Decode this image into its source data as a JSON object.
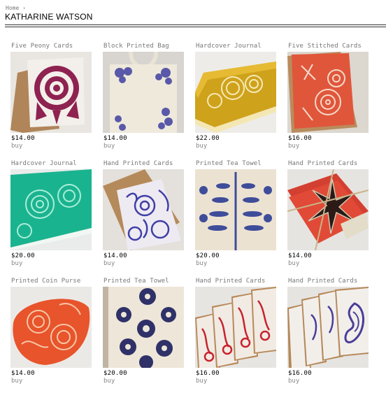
{
  "breadcrumb": {
    "home": "Home",
    "separator": "›"
  },
  "shop": {
    "title": "KATHARINE WATSON"
  },
  "products": [
    {
      "title": "Five Peony Cards",
      "price": "$14.00",
      "action": "buy",
      "image": "peony-cards-image"
    },
    {
      "title": "Block Printed Bag",
      "price": "$14.00",
      "action": "buy",
      "image": "tote-bag-image"
    },
    {
      "title": "Hardcover Journal",
      "price": "$22.00",
      "action": "buy",
      "image": "yellow-journal-image"
    },
    {
      "title": "Five Stitched Cards",
      "price": "$16.00",
      "action": "buy",
      "image": "stitched-cards-image"
    },
    {
      "title": "Hardcover Journal",
      "price": "$20.00",
      "action": "buy",
      "image": "teal-journal-image"
    },
    {
      "title": "Hand Printed Cards",
      "price": "$14.00",
      "action": "buy",
      "image": "blue-cards-image"
    },
    {
      "title": "Printed Tea Towel",
      "price": "$20.00",
      "action": "buy",
      "image": "tree-tea-towel-image"
    },
    {
      "title": "Hand Printed Cards",
      "price": "$14.00",
      "action": "buy",
      "image": "twine-cards-image"
    },
    {
      "title": "Printed Coin Purse",
      "price": "$14.00",
      "action": "buy",
      "image": "coin-purse-image"
    },
    {
      "title": "Printed Tea Towel",
      "price": "$20.00",
      "action": "buy",
      "image": "flower-tea-towel-image"
    },
    {
      "title": "Hand Printed Cards",
      "price": "$16.00",
      "action": "buy",
      "image": "red-cards-image"
    },
    {
      "title": "Hand Printed Cards",
      "price": "$16.00",
      "action": "buy",
      "image": "paisley-cards-image"
    }
  ],
  "colors": {
    "rule": "#333333",
    "meta_text": "#777777",
    "price_text": "#000000"
  }
}
